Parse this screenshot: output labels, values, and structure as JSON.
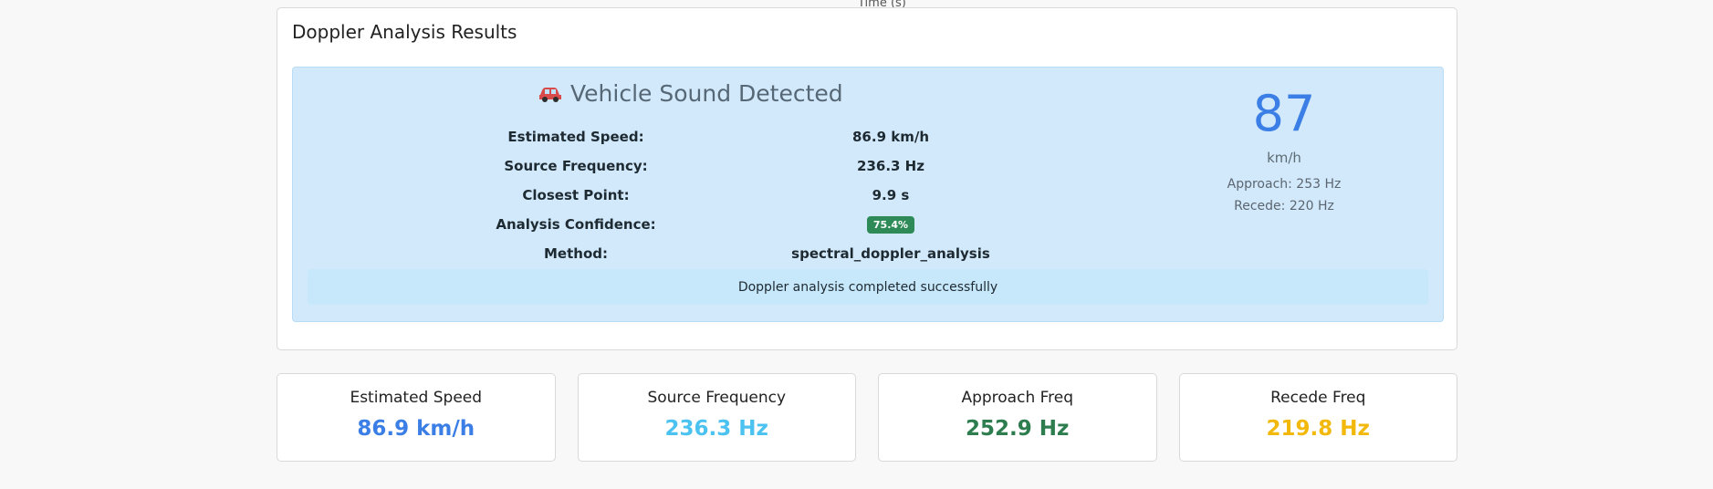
{
  "top_axis_label": "Time (s)",
  "results": {
    "title": "Doppler Analysis Results",
    "headline": "Vehicle Sound Detected",
    "rows": [
      {
        "label": "Estimated Speed:",
        "value": "86.9 km/h"
      },
      {
        "label": "Source Frequency:",
        "value": "236.3 Hz"
      },
      {
        "label": "Closest Point:",
        "value": "9.9 s"
      },
      {
        "label": "Analysis Confidence:",
        "value": "75.4%"
      },
      {
        "label": "Method:",
        "value": "spectral_doppler_analysis"
      }
    ],
    "speed_readout": "87",
    "speed_unit": "km/h",
    "approach_text": "Approach: 253 Hz",
    "recede_text": "Recede: 220 Hz",
    "status_message": "Doppler analysis completed successfully",
    "confidence_color": "#2e8b57",
    "panel_color": "#d2e9fb"
  },
  "stats": [
    {
      "label": "Estimated Speed",
      "value": "86.9 km/h",
      "color": "#3b7fe6"
    },
    {
      "label": "Source Frequency",
      "value": "236.3 Hz",
      "color": "#4cc2f0"
    },
    {
      "label": "Approach Freq",
      "value": "252.9 Hz",
      "color": "#2e7d4f"
    },
    {
      "label": "Recede Freq",
      "value": "219.8 Hz",
      "color": "#f2b90c"
    }
  ],
  "icons": {
    "vehicle_icon": "car-icon"
  }
}
